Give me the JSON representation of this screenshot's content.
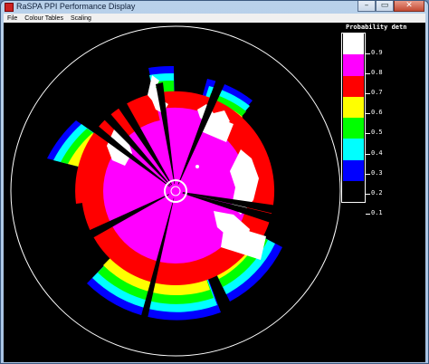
{
  "window": {
    "title": "RaSPA PPI Performance Display",
    "icon": "app-icon",
    "controls": [
      "–",
      "▭",
      "✕"
    ]
  },
  "menu": [
    {
      "label": "File"
    },
    {
      "label": "Colour Tables"
    },
    {
      "label": "Scaling"
    }
  ],
  "legend": {
    "title": "Probability detn",
    "swatches": [
      "#ffffff",
      "#ff00ff",
      "#ff0000",
      "#ffff00",
      "#00ff00",
      "#00ffff",
      "#0000ff",
      "#000000"
    ],
    "labels": [
      {
        "text": "0.9",
        "value": 0.9
      },
      {
        "text": "0.8",
        "value": 0.8
      },
      {
        "text": "0.7",
        "value": 0.7
      },
      {
        "text": "0.6",
        "value": 0.6
      },
      {
        "text": "0.5",
        "value": 0.5
      },
      {
        "text": "0.4",
        "value": 0.4
      },
      {
        "text": "0.3",
        "value": 0.3
      },
      {
        "text": "0.2",
        "value": 0.2
      },
      {
        "text": "0.1",
        "value": 0.1
      }
    ]
  },
  "colors": {
    "magenta": "#ff00ff",
    "red": "#ff0000",
    "yellow": "#ffff00",
    "green": "#00ff00",
    "cyan": "#00ffff",
    "blue": "#0000ff",
    "white": "#ffffff",
    "background": "#000000"
  }
}
